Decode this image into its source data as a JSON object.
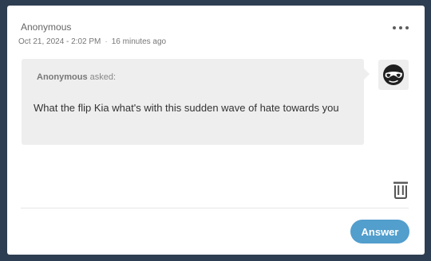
{
  "post": {
    "author": "Anonymous",
    "date": "Oct 21, 2024 - 2:02 PM",
    "separator": "·",
    "relative_time": "16 minutes ago"
  },
  "question": {
    "asker": "Anonymous",
    "asked_label": "asked:",
    "text": "What the flip Kia what's with this sudden wave of hate towards you"
  },
  "icons": {
    "more": "more-options-icon",
    "avatar": "sunglasses-avatar-icon",
    "delete": "trash-icon"
  },
  "actions": {
    "answer_label": "Answer"
  },
  "colors": {
    "background": "#2e3e52",
    "card": "#ffffff",
    "bubble": "#eeeeee",
    "accent": "#529ecc"
  }
}
